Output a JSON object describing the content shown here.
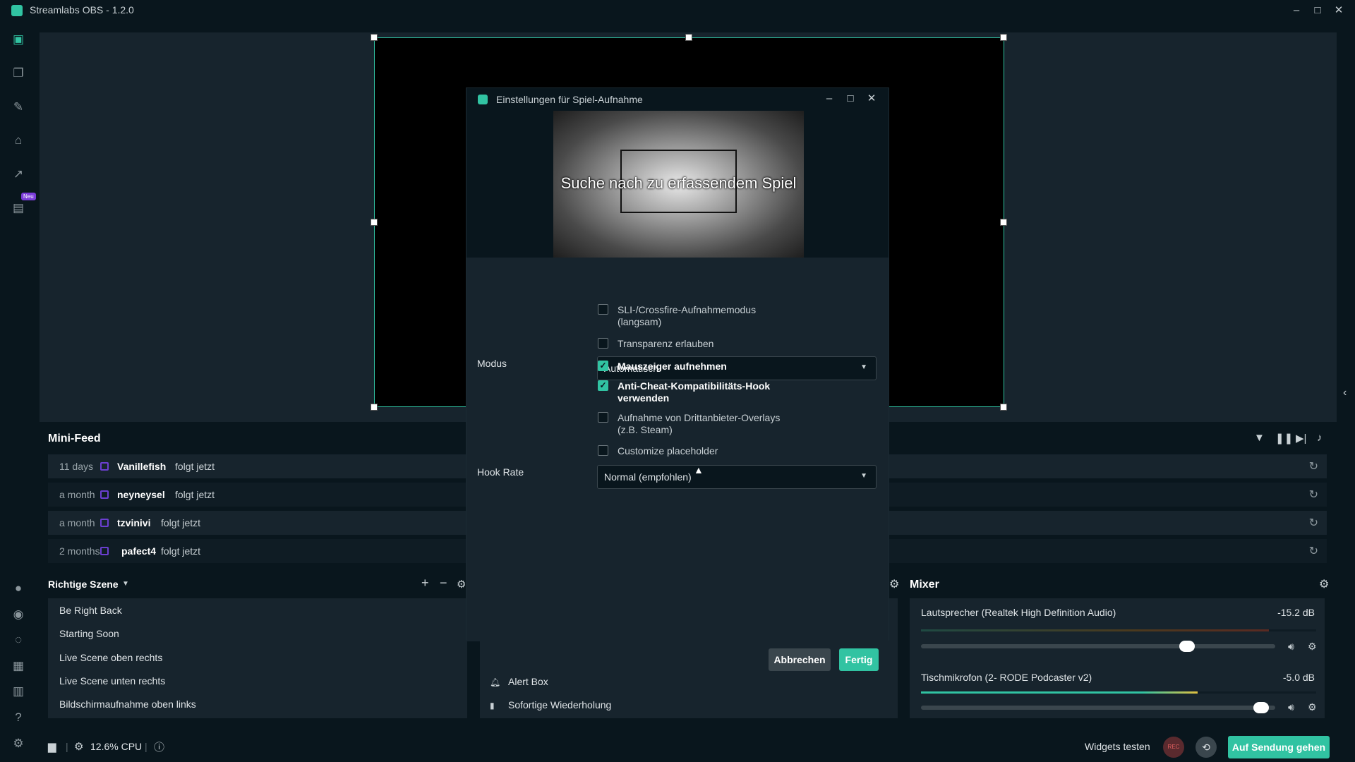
{
  "window": {
    "title": "Streamlabs OBS - 1.2.0",
    "controls": {
      "minimize": "–",
      "maximize": "□",
      "close": "✕"
    }
  },
  "nav": {
    "badge": "Neu",
    "icons": [
      "editor-icon",
      "themes-icon",
      "tools-icon",
      "store-icon",
      "stats-icon",
      "recordings-icon",
      "prime-icon",
      "alert-box-icon",
      "help-icon",
      "layouts-icon",
      "studio-mode-icon",
      "question-icon",
      "settings-icon"
    ]
  },
  "minifeed": {
    "title": "Mini-Feed",
    "items": [
      {
        "time": "11 days",
        "name": "Vanillefish",
        "action": "folgt jetzt"
      },
      {
        "time": "a month",
        "name": "neyneysel",
        "action": "folgt jetzt"
      },
      {
        "time": "a month",
        "name": "tzvinivi",
        "action": "folgt jetzt"
      },
      {
        "time": "2 months",
        "name": "pafect4",
        "action": "folgt jetzt"
      }
    ]
  },
  "scenes": {
    "title": "Richtige Szene",
    "items": [
      "Be Right Back",
      "Starting Soon",
      "Live Scene oben rechts",
      "Live Scene unten rechts",
      "Bildschirmaufnahme oben links"
    ]
  },
  "sources": {
    "items": [
      {
        "icon": "bell-icon",
        "label": "Alert Box"
      },
      {
        "icon": "document-icon",
        "label": "Sofortige Wiederholung"
      }
    ]
  },
  "mixer": {
    "title": "Mixer",
    "channels": [
      {
        "name": "Lautsprecher (Realtek High Definition Audio)",
        "db": "-15.2 dB",
        "level": 0.75,
        "meter": 0.88
      },
      {
        "name": "Tischmikrofon (2- RODE Podcaster v2)",
        "db": "-5.0 dB",
        "level": 0.96,
        "meter": 0.7
      }
    ]
  },
  "dialog": {
    "title": "Einstellungen für Spiel-Aufnahme",
    "preview_text": "Suche nach zu erfassendem Spiel",
    "mode_label": "Modus",
    "mode_value": "Automatisch",
    "options": [
      {
        "label": "SLI-/Crossfire-Aufnahmemodus (langsam)",
        "checked": false
      },
      {
        "label": "Transparenz erlauben",
        "checked": false
      },
      {
        "label": "Mauszeiger aufnehmen",
        "checked": true
      },
      {
        "label": "Anti-Cheat-Kompatibilitäts-Hook verwenden",
        "checked": true
      },
      {
        "label": "Aufnahme von Drittanbieter-Overlays (z.B. Steam)",
        "checked": false
      },
      {
        "label": "Customize placeholder",
        "checked": false
      }
    ],
    "hook_rate_label": "Hook Rate",
    "hook_rate_value": "Normal (empfohlen)",
    "cancel_label": "Abbrechen",
    "done_label": "Fertig"
  },
  "footer": {
    "cpu": "12.6% CPU",
    "widgets_test": "Widgets testen",
    "rec_label": "REC",
    "go_live": "Auf Sendung gehen"
  },
  "colors": {
    "accent": "#31c3a2",
    "bg": "#09161d",
    "panel": "#17242d",
    "follow": "#6b3fd0"
  }
}
